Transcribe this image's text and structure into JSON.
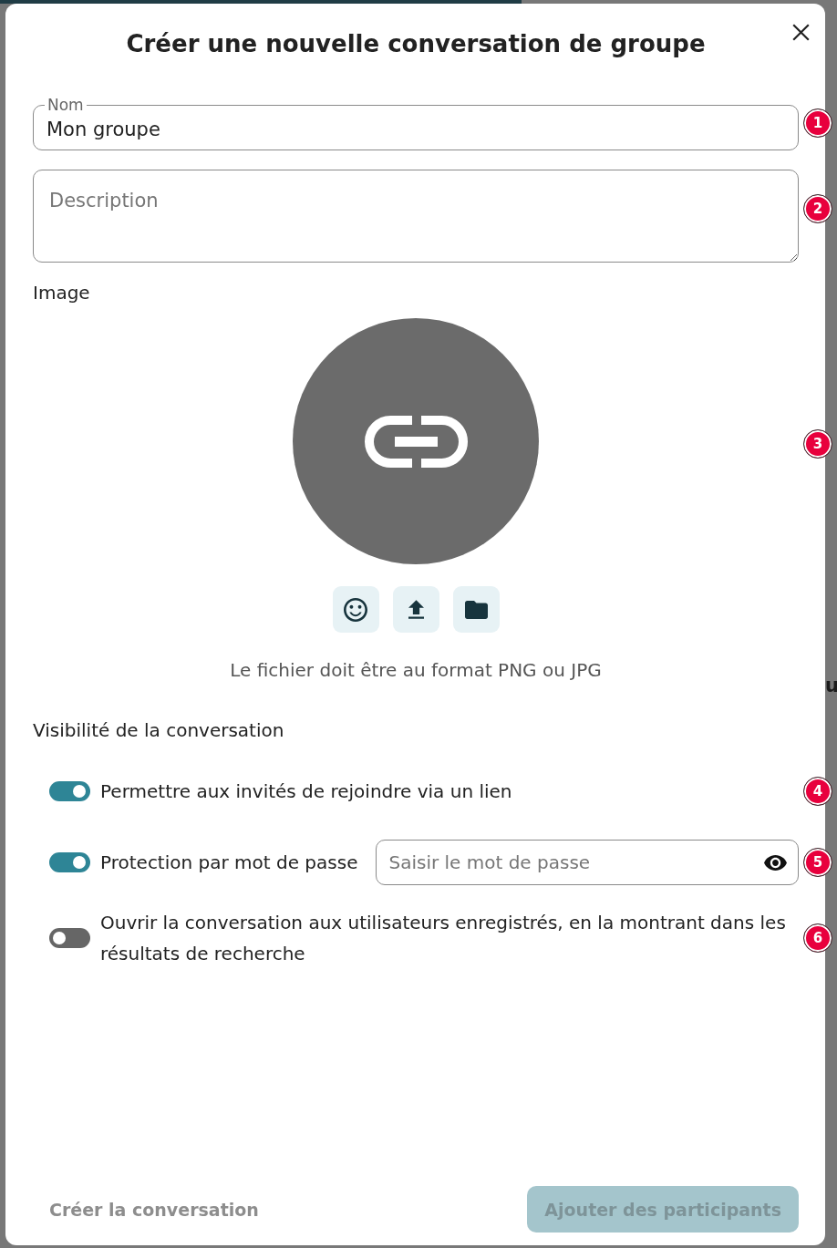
{
  "dialog": {
    "title": "Créer une nouvelle conversation de groupe"
  },
  "name_field": {
    "label": "Nom",
    "value": "Mon groupe",
    "marker": "1"
  },
  "description_field": {
    "placeholder": "Description",
    "marker": "2"
  },
  "image": {
    "label": "Image",
    "hint": "Le fichier doit être au format PNG ou JPG",
    "marker": "3"
  },
  "visibility": {
    "heading": "Visibilité de la conversation",
    "options": [
      {
        "kind": "toggle",
        "label": "Permettre aux invités de rejoindre via un lien",
        "on": true,
        "marker": "4"
      },
      {
        "kind": "toggle_with_password",
        "label": "Protection par mot de passe",
        "on": true,
        "password_placeholder": "Saisir le mot de passe",
        "marker": "5"
      },
      {
        "kind": "toggle",
        "label": "Ouvrir la conversation aux utilisateurs enregistrés, en la montrant dans les résultats de recherche",
        "on": false,
        "marker": "6"
      }
    ]
  },
  "footer_buttons": [
    {
      "kind": "text",
      "label": "Créer la conversation",
      "disabled": true
    },
    {
      "kind": "filled",
      "label": "Ajouter des participants",
      "disabled": true
    }
  ],
  "backdrop": {
    "text": "u"
  }
}
